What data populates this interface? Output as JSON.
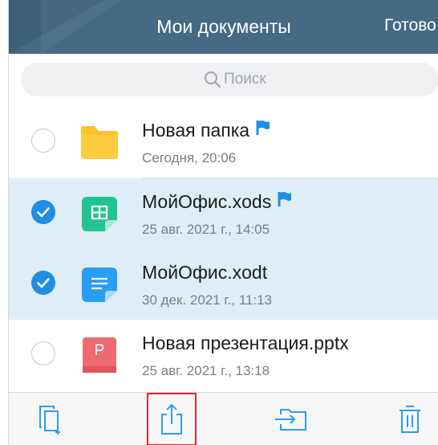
{
  "header": {
    "title": "Мои документы",
    "done_label": "Готово"
  },
  "search": {
    "placeholder": "Поиск",
    "icon": "search-icon"
  },
  "files": [
    {
      "name": "Новая папка",
      "date": "Сегодня, 20:06",
      "type": "folder",
      "selected": false,
      "flagged": true
    },
    {
      "name": "МойОфис.xods",
      "date": "25 авг. 2021 г., 14:05",
      "type": "spreadsheet",
      "selected": true,
      "flagged": true
    },
    {
      "name": "МойОфис.xodt",
      "date": "30 дек. 2021 г., 11:13",
      "type": "text-document",
      "selected": true,
      "flagged": false
    },
    {
      "name": "Новая презентация.pptx",
      "date": "25 авг. 2021 г., 13:18",
      "type": "presentation",
      "selected": false,
      "flagged": false,
      "icon_letter": "P"
    }
  ],
  "toolbar": {
    "buttons": [
      {
        "icon": "copy-icon"
      },
      {
        "icon": "share-icon",
        "highlighted": true
      },
      {
        "icon": "move-to-folder-icon"
      },
      {
        "icon": "trash-icon"
      }
    ]
  },
  "colors": {
    "header_bg": "#466a84",
    "selection_bg": "#dfedf6",
    "accent": "#1e8fe3",
    "folder": "#fdc230",
    "spreadsheet": "#22c38f",
    "text_document": "#2a9ef0",
    "presentation": "#ee6a73",
    "highlight_box": "#e8232a"
  }
}
